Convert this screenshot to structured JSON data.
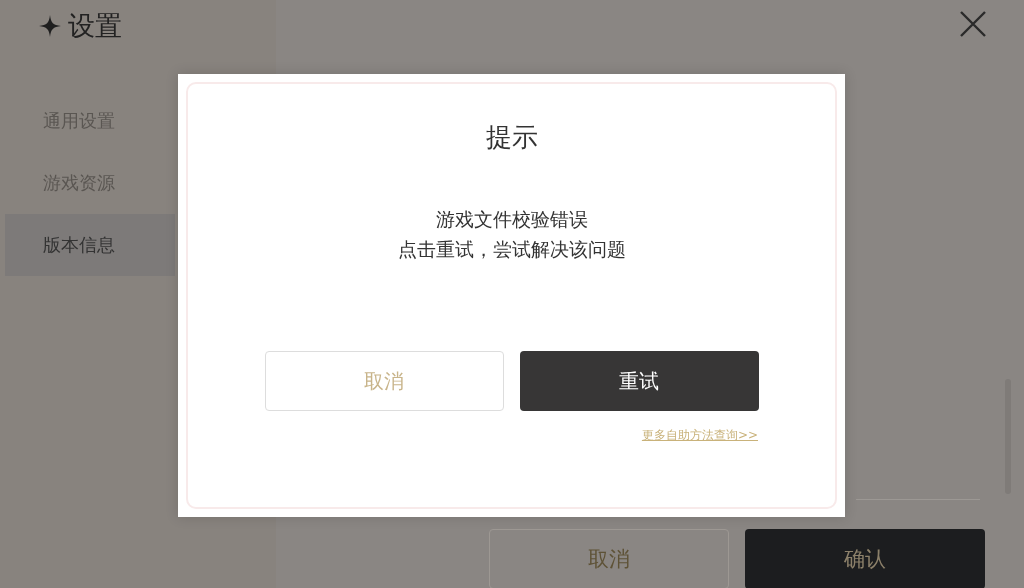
{
  "settings": {
    "title": "设置",
    "sidebar": {
      "items": [
        {
          "label": "通用设置",
          "selected": false
        },
        {
          "label": "游戏资源",
          "selected": false
        },
        {
          "label": "版本信息",
          "selected": true
        }
      ]
    },
    "buttons": [
      {
        "label": "取消",
        "kind": "secondary"
      },
      {
        "label": "确认",
        "kind": "primary"
      }
    ]
  },
  "dialog": {
    "title": "提示",
    "message": [
      "游戏文件校验错误",
      "点击重试，尝试解决该问题"
    ],
    "buttons": [
      {
        "label": "取消",
        "kind": "secondary"
      },
      {
        "label": "重试",
        "kind": "primary"
      }
    ],
    "link": "更多自助方法查询>>"
  }
}
